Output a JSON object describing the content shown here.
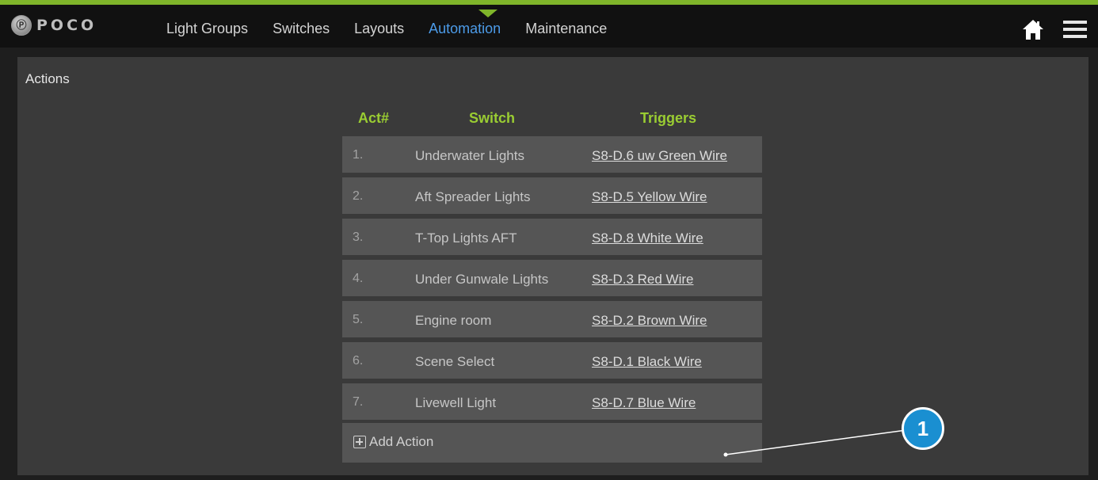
{
  "brand": {
    "logo_mark": "Ⓟ",
    "logo_text": "POCO"
  },
  "nav": {
    "items": [
      {
        "label": "Light Groups",
        "active": false
      },
      {
        "label": "Switches",
        "active": false
      },
      {
        "label": "Layouts",
        "active": false
      },
      {
        "label": "Automation",
        "active": true
      },
      {
        "label": "Maintenance",
        "active": false
      }
    ],
    "icons": [
      "home-icon",
      "hamburger-menu-icon"
    ]
  },
  "colors": {
    "accent_green": "#7fb52a",
    "active_nav": "#4c9be8",
    "header_green": "#9acd32",
    "callout_blue": "#1a8fd1"
  },
  "panel": {
    "title": "Actions",
    "columns": [
      "Act#",
      "Switch",
      "Triggers"
    ],
    "rows": [
      {
        "num": "1.",
        "switch": "Underwater Lights",
        "trigger": "S8-D.6 uw Green Wire"
      },
      {
        "num": "2.",
        "switch": "Aft Spreader Lights",
        "trigger": "S8-D.5 Yellow Wire"
      },
      {
        "num": "3.",
        "switch": "T-Top Lights AFT",
        "trigger": "S8-D.8 White Wire"
      },
      {
        "num": "4.",
        "switch": "Under Gunwale Lights",
        "trigger": "S8-D.3 Red Wire"
      },
      {
        "num": "5.",
        "switch": "Engine room",
        "trigger": "S8-D.2 Brown Wire"
      },
      {
        "num": "6.",
        "switch": "Scene Select",
        "trigger": "S8-D.1 Black Wire"
      },
      {
        "num": "7.",
        "switch": "Livewell Light",
        "trigger": "S8-D.7 Blue Wire"
      }
    ],
    "add_action_label": "Add Action"
  },
  "callout": {
    "label": "1"
  }
}
